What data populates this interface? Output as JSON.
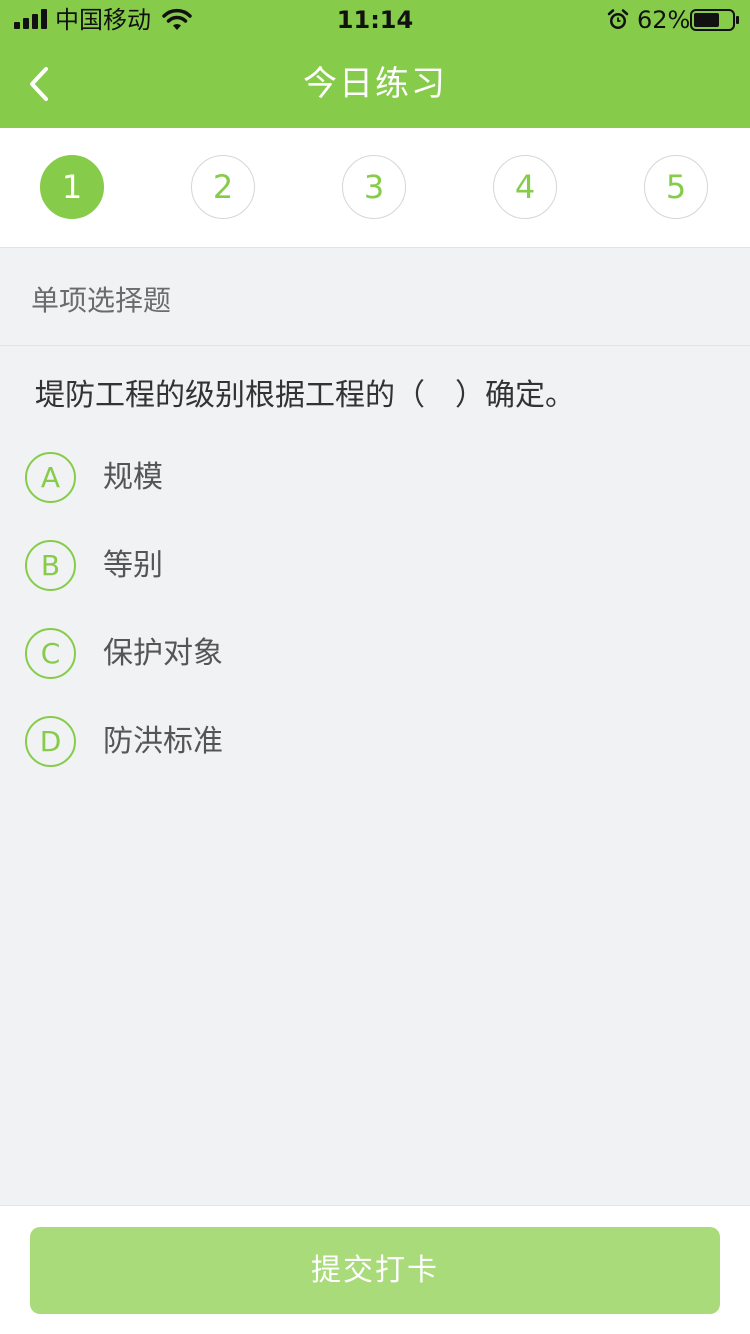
{
  "status_bar": {
    "carrier": "中国移动",
    "time": "11:14",
    "battery_percent": "62%"
  },
  "nav": {
    "title": "今日练习"
  },
  "steps": {
    "items": [
      "1",
      "2",
      "3",
      "4",
      "5"
    ],
    "active_index": 0
  },
  "question": {
    "type_label": "单项选择题",
    "text": "堤防工程的级别根据工程的（　）确定。",
    "options": [
      {
        "letter": "A",
        "text": "规模"
      },
      {
        "letter": "B",
        "text": "等别"
      },
      {
        "letter": "C",
        "text": "保护对象"
      },
      {
        "letter": "D",
        "text": "防洪标准"
      }
    ]
  },
  "footer": {
    "submit_label": "提交打卡"
  },
  "colors": {
    "brand_green": "#86cc4a",
    "submit_disabled": "#a9db7a",
    "background": "#f1f2f4"
  },
  "icons": [
    "signal-icon",
    "wifi-icon",
    "alarm-icon",
    "battery-icon",
    "back-icon"
  ]
}
